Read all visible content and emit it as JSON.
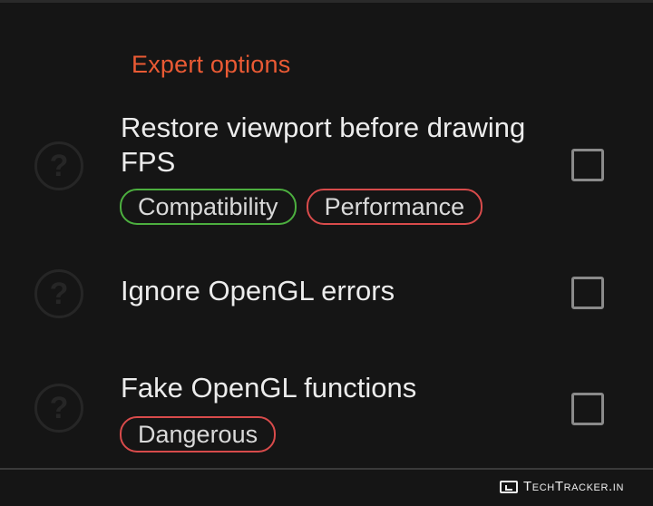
{
  "section": {
    "title": "Expert options"
  },
  "options": [
    {
      "title": "Restore viewport before drawing FPS",
      "tags": [
        "Compatibility",
        "Performance"
      ],
      "checked": false
    },
    {
      "title": "Ignore OpenGL errors",
      "tags": [],
      "checked": false
    },
    {
      "title": "Fake OpenGL functions",
      "tags": [
        "Dangerous"
      ],
      "checked": false
    }
  ],
  "help_icon_glyph": "?",
  "colors": {
    "accent": "#ea5a34",
    "tag_green": "#4caf3f",
    "tag_red": "#d84b4b",
    "background": "#151515"
  },
  "watermark": {
    "text": "TechTracker.in"
  }
}
